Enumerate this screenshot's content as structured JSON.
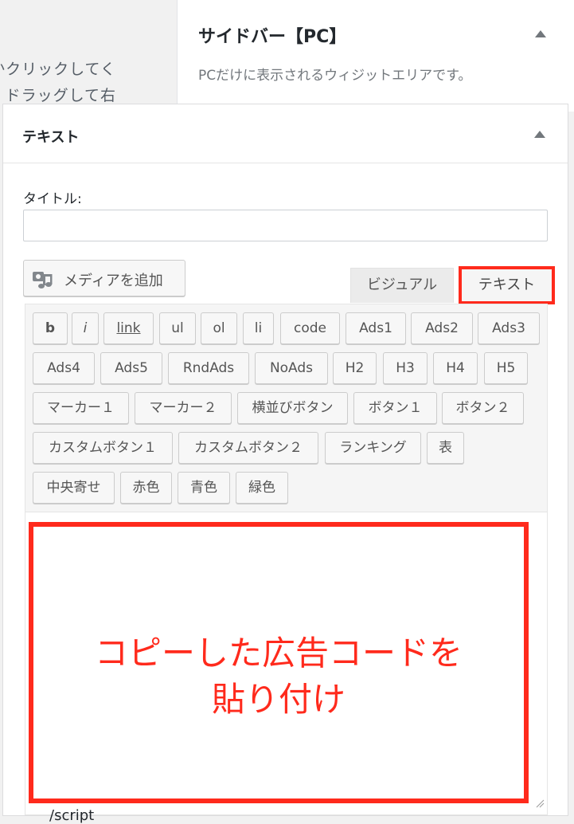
{
  "background_text": {
    "line1": "かクリックしてく",
    "line2": "ドラッグして右"
  },
  "sidebar_widget_area": {
    "title": "サイドバー【PC】",
    "description": "PCだけに表示されるウィジットエリアです。",
    "toggle_icon": "triangle-up-icon"
  },
  "text_widget": {
    "title": "テキスト",
    "toggle_icon": "triangle-up-icon",
    "title_field_label": "タイトル:",
    "title_field_value": "",
    "add_media_label": "メディアを追加",
    "add_media_icon": "media-icon",
    "tabs": {
      "visual": "ビジュアル",
      "text": "テキスト"
    },
    "quicktags": [
      "b",
      "i",
      "link",
      "ul",
      "ol",
      "li",
      "code",
      "Ads1",
      "Ads2",
      "Ads3",
      "Ads4",
      "Ads5",
      "RndAds",
      "NoAds",
      "H2",
      "H3",
      "H4",
      "H5",
      "マーカー１",
      "マーカー２",
      "横並びボタン",
      "ボタン１",
      "ボタン２",
      "カスタムボタン１",
      "カスタムボタン２",
      "ランキング",
      "表",
      "中央寄せ",
      "赤色",
      "青色",
      "緑色"
    ],
    "editor_partial_text": "/script",
    "annotation": {
      "line1": "コピーした広告コードを",
      "line2": "貼り付け"
    }
  },
  "colors": {
    "highlight": "#ff2a1c",
    "panel_background": "#ffffff",
    "page_background": "#f1f1f1"
  }
}
